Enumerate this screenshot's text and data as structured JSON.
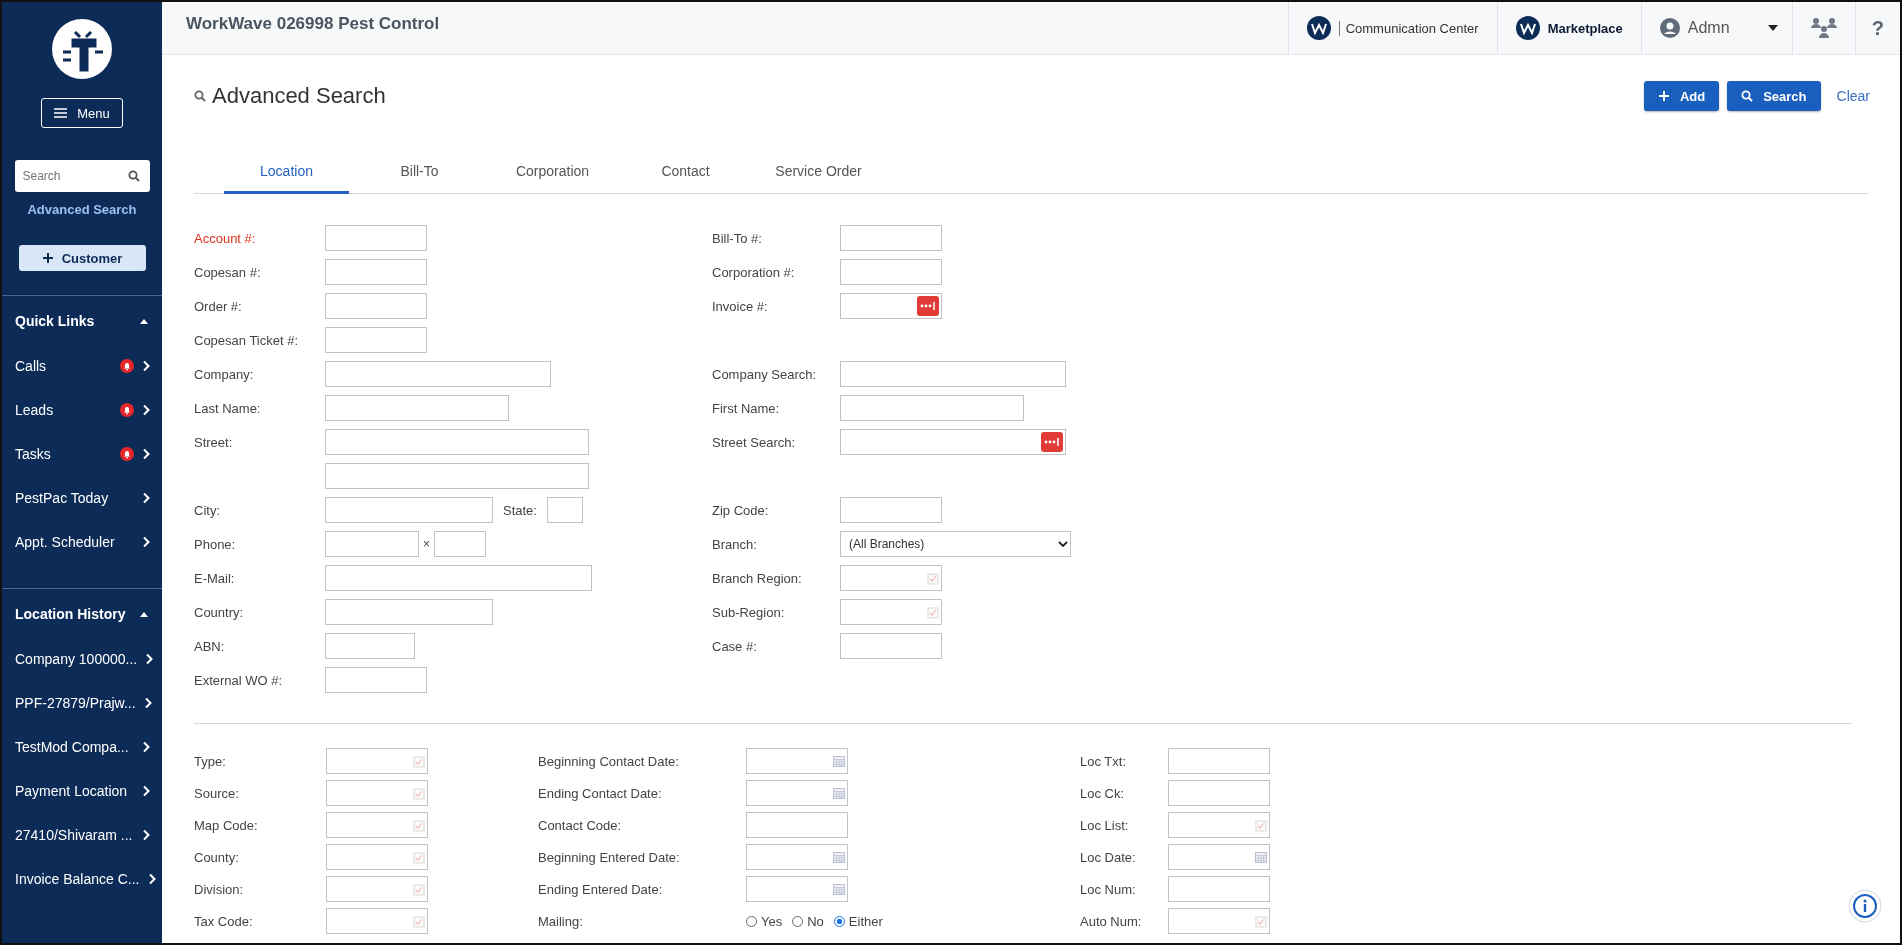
{
  "sidebar": {
    "menu_button": "Menu",
    "search": {
      "placeholder": "Search"
    },
    "advanced_search_link": "Advanced Search",
    "customer_button": "Customer",
    "sections": [
      {
        "title": "Quick Links",
        "expanded": true,
        "items": [
          {
            "label": "Calls",
            "alert": true
          },
          {
            "label": "Leads",
            "alert": true
          },
          {
            "label": "Tasks",
            "alert": true
          },
          {
            "label": "PestPac Today",
            "alert": false
          },
          {
            "label": "Appt. Scheduler",
            "alert": false
          }
        ]
      },
      {
        "title": "Location History",
        "expanded": true,
        "items": [
          {
            "label": "Company 100000...",
            "alert": false
          },
          {
            "label": "PPF-27879/Prajw...",
            "alert": false
          },
          {
            "label": "TestMod Compa...",
            "alert": false
          },
          {
            "label": "Payment Location",
            "alert": false
          },
          {
            "label": "27410/Shivaram ...",
            "alert": false
          },
          {
            "label": "Invoice Balance C...",
            "alert": false
          }
        ]
      }
    ]
  },
  "header": {
    "title": "WorkWave 026998 Pest Control",
    "communication_center": "Communication Center",
    "marketplace": "Marketplace",
    "user": "Admn",
    "help": "?"
  },
  "page": {
    "title": "Advanced Search",
    "actions": {
      "add": "Add",
      "search": "Search",
      "clear": "Clear"
    }
  },
  "tabs": [
    {
      "label": "Location",
      "selected": true
    },
    {
      "label": "Bill-To",
      "selected": false
    },
    {
      "label": "Corporation",
      "selected": false
    },
    {
      "label": "Contact",
      "selected": false
    },
    {
      "label": "Service Order",
      "selected": false
    }
  ],
  "form_rows": [
    {
      "left": {
        "label": "Account #:",
        "kind": "text",
        "required": true
      },
      "right": {
        "label": "Bill-To #:",
        "kind": "text",
        "required": false
      }
    },
    {
      "left": {
        "label": "Copesan #:",
        "kind": "text",
        "required": false
      },
      "right": {
        "label": "Corporation #:",
        "kind": "text",
        "required": false
      }
    },
    {
      "left": {
        "label": "Order #:",
        "kind": "text",
        "required": false
      },
      "right": {
        "label": "Invoice #:",
        "kind": "lookup",
        "required": false
      }
    },
    {
      "left": {
        "label": "Copesan Ticket #:",
        "kind": "text",
        "required": false
      },
      "right": null
    },
    {
      "left": {
        "label": "Company:",
        "kind": "text",
        "required": false
      },
      "right": {
        "label": "Company Search:",
        "kind": "text",
        "required": false
      }
    },
    {
      "left": {
        "label": "Last Name:",
        "kind": "text",
        "required": false
      },
      "right": {
        "label": "First Name:",
        "kind": "text",
        "required": false
      }
    },
    {
      "left": {
        "label": "Street:",
        "kind": "text",
        "required": false
      },
      "right": {
        "label": "Street Search:",
        "kind": "lookup",
        "required": false
      }
    },
    {
      "left": {
        "kind": "text"
      },
      "right": null
    },
    {
      "left": {
        "label": "City:",
        "kind": "city_state",
        "required": false,
        "state_label": "State:"
      },
      "right": {
        "label": "Zip Code:",
        "kind": "text",
        "required": false
      }
    },
    {
      "left": {
        "label": "Phone:",
        "kind": "phone",
        "required": false,
        "ext_mark": "×"
      },
      "right": {
        "label": "Branch:",
        "kind": "select",
        "required": false,
        "value": "(All Branches)"
      }
    },
    {
      "left": {
        "label": "E-Mail:",
        "kind": "text",
        "required": false
      },
      "right": {
        "label": "Branch Region:",
        "kind": "picker",
        "required": false
      }
    },
    {
      "left": {
        "label": "Country:",
        "kind": "text",
        "required": false
      },
      "right": {
        "label": "Sub-Region:",
        "kind": "picker",
        "required": false
      }
    },
    {
      "left": {
        "label": "ABN:",
        "kind": "text",
        "required": false
      },
      "right": {
        "label": "Case #:",
        "kind": "text",
        "required": false
      }
    },
    {
      "left": {
        "label": "External WO #:",
        "kind": "text",
        "required": false
      },
      "right": null
    }
  ],
  "more_rows": [
    [
      {
        "label": "Type:",
        "kind": "picker"
      },
      {
        "label": "Beginning Contact Date:",
        "kind": "date"
      },
      {
        "label": "Loc Txt:",
        "kind": "text"
      }
    ],
    [
      {
        "label": "Source:",
        "kind": "picker"
      },
      {
        "label": "Ending Contact Date:",
        "kind": "date"
      },
      {
        "label": "Loc Ck:",
        "kind": "text"
      }
    ],
    [
      {
        "label": "Map Code:",
        "kind": "picker"
      },
      {
        "label": "Contact Code:",
        "kind": "text"
      },
      {
        "label": "Loc List:",
        "kind": "picker"
      }
    ],
    [
      {
        "label": "County:",
        "kind": "picker"
      },
      {
        "label": "Beginning Entered Date:",
        "kind": "date"
      },
      {
        "label": "Loc Date:",
        "kind": "date"
      }
    ],
    [
      {
        "label": "Division:",
        "kind": "picker"
      },
      {
        "label": "Ending Entered Date:",
        "kind": "date"
      },
      {
        "label": "Loc Num:",
        "kind": "text"
      }
    ],
    [
      {
        "label": "Tax Code:",
        "kind": "picker"
      },
      {
        "label": "Mailing:",
        "kind": "radio",
        "options": [
          {
            "label": "Yes",
            "selected": false
          },
          {
            "label": "No",
            "selected": false
          },
          {
            "label": "Either",
            "selected": true
          }
        ]
      },
      {
        "label": "Auto Num:",
        "kind": "picker"
      }
    ]
  ]
}
